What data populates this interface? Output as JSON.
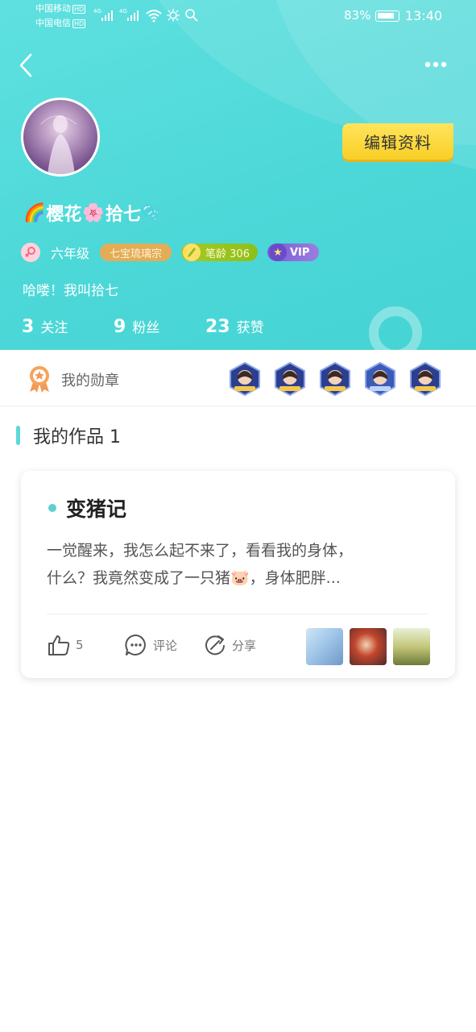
{
  "status_bar": {
    "carrier1": "中国移动",
    "carrier2": "中国电信",
    "hd": "HD",
    "network": "4G",
    "battery": "83%",
    "time": "13:40"
  },
  "profile": {
    "name": "樱花",
    "name_suffix": "拾七",
    "emoji_rainbow": "🌈",
    "emoji_blossom": "🌸",
    "emoji_bubble": "🫧",
    "edit_button": "编辑资料",
    "grade": "六年级",
    "sect_badge": "七宝琉璃宗",
    "pen_age": "笔龄 306",
    "vip": "VIP",
    "bio": "哈喽！我叫拾七"
  },
  "stats": [
    {
      "num": "3",
      "label": "关注"
    },
    {
      "num": "9",
      "label": "粉丝"
    },
    {
      "num": "23",
      "label": "获赞"
    }
  ],
  "medals": {
    "label": "我的勋章",
    "count": 5
  },
  "works": {
    "title": "我的作品 1",
    "items": [
      {
        "title": "变猪记",
        "excerpt_line1": "一觉醒来，我怎么起不来了，看看我的身体，",
        "excerpt_line2": "什么？我竟然变成了一只猪🐷，身体肥胖...",
        "likes": "5",
        "comment_label": "评论",
        "share_label": "分享"
      }
    ]
  },
  "colors": {
    "header_bg": "#4dd8d8",
    "edit_button_bg": "#f9cf26",
    "accent": "#5fcfcf"
  }
}
